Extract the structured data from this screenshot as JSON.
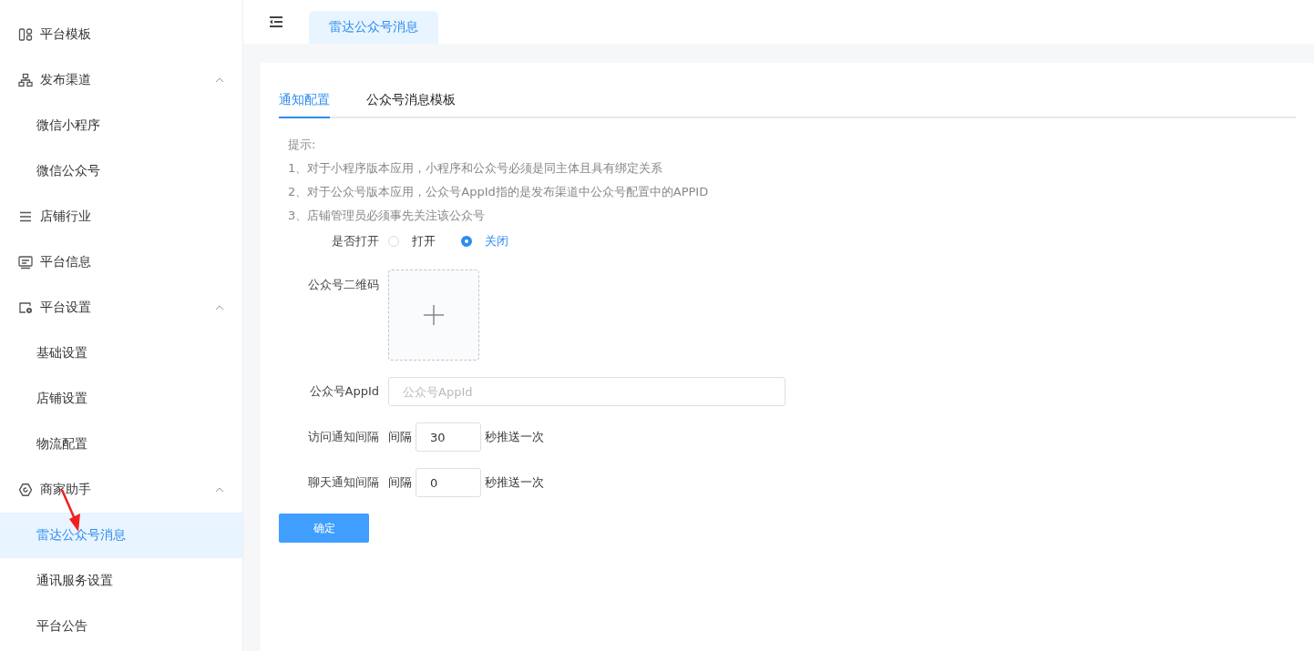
{
  "sidebar": {
    "items": [
      {
        "label": "平台模板"
      },
      {
        "label": "发布渠道",
        "expanded": true,
        "children": [
          {
            "label": "微信小程序",
            "selected": false
          },
          {
            "label": "微信公众号",
            "selected": false
          }
        ]
      },
      {
        "label": "店铺行业"
      },
      {
        "label": "平台信息"
      },
      {
        "label": "平台设置",
        "expanded": true,
        "children": [
          {
            "label": "基础设置",
            "selected": false
          },
          {
            "label": "店铺设置",
            "selected": false
          },
          {
            "label": "物流配置",
            "selected": false
          }
        ]
      },
      {
        "label": "商家助手",
        "expanded": true,
        "children": [
          {
            "label": "雷达公众号消息",
            "selected": true
          },
          {
            "label": "通讯服务设置",
            "selected": false
          },
          {
            "label": "平台公告",
            "selected": false
          }
        ]
      }
    ]
  },
  "page_tabs": [
    {
      "label": "雷达公众号消息",
      "selected": true
    }
  ],
  "tabs": [
    {
      "label": "通知配置",
      "selected": true
    },
    {
      "label": "公众号消息模板",
      "selected": false
    }
  ],
  "tips": [
    "提示:",
    "1、对于小程序版本应用，小程序和公众号必须是同主体且具有绑定关系",
    "2、对于公众号版本应用，公众号AppId指的是发布渠道中公众号配置中的APPID",
    "3、店铺管理员必须事先关注该公众号"
  ],
  "open_switch": {
    "label": "是否打开",
    "options": [
      {
        "label": "打开",
        "selected": false
      },
      {
        "label": "关闭",
        "selected": true
      }
    ]
  },
  "qr_code": {
    "label": "公众号二维码"
  },
  "appid": {
    "label": "公众号AppId",
    "placeholder": "公众号AppId"
  },
  "intervals": [
    {
      "label": "访问通知间隔",
      "prefix": "间隔",
      "value": "30",
      "suffix": "秒推送一次"
    },
    {
      "label": "聊天通知间隔",
      "prefix": "间隔",
      "value": "0",
      "suffix": "秒推送一次"
    }
  ],
  "submit": "确定"
}
